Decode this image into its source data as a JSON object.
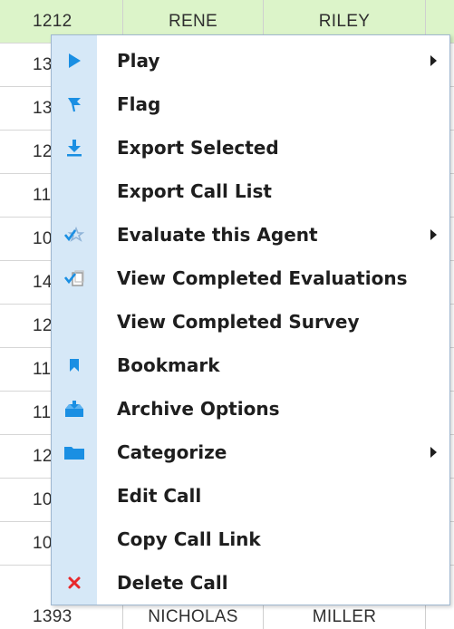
{
  "grid": {
    "rows": [
      {
        "id": "1212",
        "first": "RENE",
        "last": "RILEY",
        "selected": true
      },
      {
        "id": "13",
        "first": "",
        "last": ""
      },
      {
        "id": "13",
        "first": "",
        "last": ""
      },
      {
        "id": "12",
        "first": "",
        "last": ""
      },
      {
        "id": "11",
        "first": "",
        "last": ""
      },
      {
        "id": "10",
        "first": "",
        "last": ""
      },
      {
        "id": "14",
        "first": "",
        "last": ""
      },
      {
        "id": "12",
        "first": "",
        "last": ""
      },
      {
        "id": "11",
        "first": "",
        "last": ""
      },
      {
        "id": "11",
        "first": "",
        "last": ""
      },
      {
        "id": "12",
        "first": "",
        "last": ""
      },
      {
        "id": "10",
        "first": "",
        "last": ""
      },
      {
        "id": "10",
        "first": "",
        "last": ""
      },
      {
        "id": "1393",
        "first": "NICHOLAS",
        "last": "MILLER"
      }
    ]
  },
  "menu": {
    "items": [
      {
        "label": "Play",
        "icon": "play-icon",
        "submenu": true
      },
      {
        "label": "Flag",
        "icon": "flag-icon",
        "submenu": false
      },
      {
        "label": "Export Selected",
        "icon": "download-icon",
        "submenu": false
      },
      {
        "label": "Export Call List",
        "icon": "",
        "submenu": false
      },
      {
        "label": "Evaluate this Agent",
        "icon": "evaluate-icon",
        "submenu": true
      },
      {
        "label": "View Completed Evaluations",
        "icon": "checklist-icon",
        "submenu": false
      },
      {
        "label": "View Completed Survey",
        "icon": "",
        "submenu": false
      },
      {
        "label": "Bookmark",
        "icon": "bookmark-icon",
        "submenu": false
      },
      {
        "label": "Archive Options",
        "icon": "archive-icon",
        "submenu": false
      },
      {
        "label": "Categorize",
        "icon": "folder-icon",
        "submenu": true
      },
      {
        "label": "Edit Call",
        "icon": "",
        "submenu": false
      },
      {
        "label": "Copy Call Link",
        "icon": "",
        "submenu": false
      },
      {
        "label": "Delete Call",
        "icon": "delete-icon",
        "submenu": false
      }
    ]
  },
  "colors": {
    "selected_row": "#dcf4c9",
    "menu_gutter": "#d6e8f7",
    "icon_blue": "#1a8fe3",
    "delete_red": "#e8282b"
  }
}
